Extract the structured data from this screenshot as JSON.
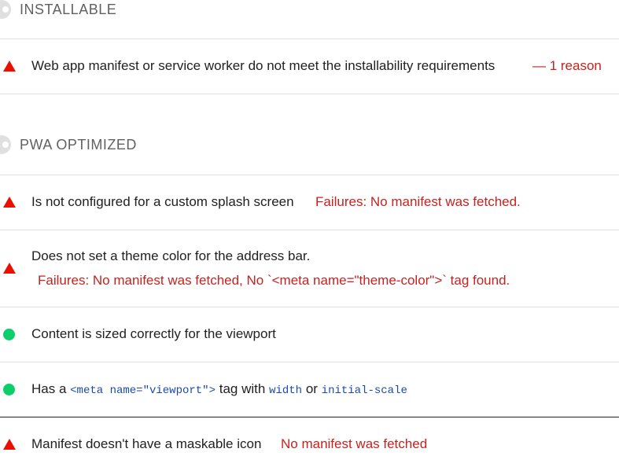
{
  "colors": {
    "fail": "#eb0f00",
    "pass": "#0cce6b",
    "fail_text": "#c7221f",
    "code": "#1a49b0"
  },
  "groups": {
    "installable": {
      "title": "INSTALLABLE"
    },
    "pwa_optimized": {
      "title": "PWA OPTIMIZED"
    }
  },
  "audits": {
    "installable_manifest": {
      "status": "fail",
      "title": "Web app manifest or service worker do not meet the installability requirements",
      "detail": "— 1 reason"
    },
    "splash_screen": {
      "status": "fail",
      "title": "Is not configured for a custom splash screen",
      "detail": "Failures: No manifest was fetched."
    },
    "theme_color": {
      "status": "fail",
      "title": "Does not set a theme color for the address bar.",
      "detail": "Failures: No manifest was fetched, No `<meta name=\"theme-color\">` tag found."
    },
    "content_width": {
      "status": "pass",
      "title": "Content is sized correctly for the viewport"
    },
    "viewport": {
      "status": "pass",
      "prefix": "Has a",
      "code_tag": "<meta name=\"viewport\">",
      "middle": "tag with",
      "code_width": "width",
      "or": "or",
      "code_scale": "initial-scale"
    },
    "maskable_icon": {
      "status": "fail",
      "title": "Manifest doesn't have a maskable icon",
      "detail": "No manifest was fetched"
    }
  }
}
